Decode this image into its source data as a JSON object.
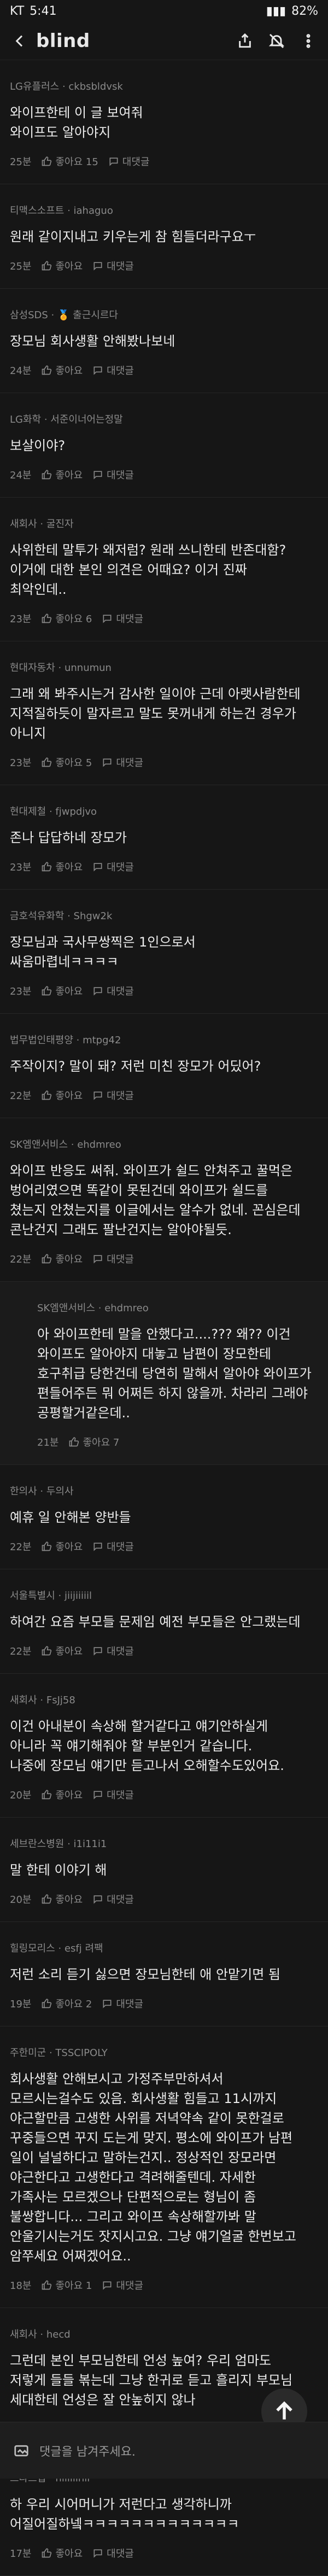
{
  "status": {
    "carrier": "KT",
    "time": "5:41",
    "battery": "82%"
  },
  "app": {
    "brand": "blind"
  },
  "comments": [
    {
      "author": "LG유플러스 · ckbsbldvsk",
      "text": "와이프한테 이 글 보여줘\n와이프도 알아야지",
      "time": "25분",
      "likes": "좋아요 15",
      "reply": "대댓글"
    },
    {
      "author": "티맥스소프트 · iahaguo",
      "text": "원래 같이지내고 키우는게 참 힘들더라구요ㅜ",
      "time": "25분",
      "likes": "좋아요",
      "reply": "대댓글"
    },
    {
      "author": "삼성SDS · 🏅 출근시르다",
      "text": "장모님 회사생활 안해봤나보네",
      "time": "24분",
      "likes": "좋아요",
      "reply": "대댓글"
    },
    {
      "author": "LG화학 · 서준이너어는정말",
      "text": "보살이야?",
      "time": "24분",
      "likes": "좋아요",
      "reply": "대댓글"
    },
    {
      "author": "새회사 · 굴진자",
      "text": "사위한테 말투가 왜저럼? 원래 쓰니한테 반존대함?\n이거에 대한 본인 의견은 어때요? 이거 진짜\n최악인데..",
      "time": "23분",
      "likes": "좋아요 6",
      "reply": "대댓글"
    },
    {
      "author": "현대자동차 · unnumun",
      "text": "그래 왜 봐주시는거 감사한 일이야 근데 아랫사람한테\n지적질하듯이 말자르고 말도 못꺼내게 하는건 경우가\n아니지",
      "time": "23분",
      "likes": "좋아요 5",
      "reply": "대댓글"
    },
    {
      "author": "현대제철 · fjwpdjvo",
      "text": "존나 답답하네 장모가",
      "time": "23분",
      "likes": "좋아요",
      "reply": "대댓글"
    },
    {
      "author": "금호석유화학 · Shgw2k",
      "text": "장모님과 국사무쌍찍은 1인으로서\n싸움마렵네ㅋㅋㅋㅋ",
      "time": "23분",
      "likes": "좋아요",
      "reply": "대댓글"
    },
    {
      "author": "법무법인태평양 · mtpg42",
      "text": "주작이지? 말이 돼? 저런 미친 장모가 어딨어?",
      "time": "22분",
      "likes": "좋아요",
      "reply": "대댓글"
    },
    {
      "author": "SK엠앤서비스 · ehdmreo",
      "text": "와이프 반응도 써줘. 와이프가 쉴드 안쳐주고 꿀먹은\n벙어리였으면 똑같이 못된건데 와이프가 쉴드를\n쳤는지 안쳤는지를 이글에서는 알수가 없네. 꼰심은데\n콘난건지 그래도 팔난건지는 알아야될듯.",
      "time": "22분",
      "likes": "좋아요",
      "reply": "대댓글"
    },
    {
      "reply_item": true,
      "author": "SK엠앤서비스 · ehdmreo",
      "text": "아 와이프한테 말을 안했다고....??? 왜?? 이건\n와이프도 알아야지 대놓고 남편이 장모한테\n호구취급 당한건데 당연히 말해서 알아야 와이프가\n편들어주든 뭐 어쩌든 하지 않을까. 차라리 그래야\n공평할거같은데..",
      "time": "21분",
      "likes": "좋아요 7",
      "reply": ""
    },
    {
      "author": "한의사 · 두의사",
      "text": "예휴 일 안해본 양반들",
      "time": "22분",
      "likes": "좋아요",
      "reply": "대댓글"
    },
    {
      "author": "서울특별시 · jiijiiiiil",
      "text": "하여간 요즘 부모들 문제임 예전 부모들은 안그랬는데",
      "time": "22분",
      "likes": "좋아요",
      "reply": "대댓글"
    },
    {
      "author": "새회사 · FsJj58",
      "text": "이건 아내분이 속상해 할거같다고 얘기안하실게\n아니라 꼭 얘기해줘야 할 부분인거 같습니다.\n나중에 장모님 얘기만 듣고나서 오해할수도있어요.",
      "time": "20분",
      "likes": "좋아요",
      "reply": "대댓글"
    },
    {
      "author": "세브란스병원 · i1i11i1",
      "text": "말 한테 이야기 해",
      "time": "20분",
      "likes": "좋아요",
      "reply": "대댓글"
    },
    {
      "author": "힐링모리스 · esfj 려팩",
      "text": "저런 소리 듣기 싫으면 장모님한테 애 안맡기면 됨",
      "time": "19분",
      "likes": "좋아요 2",
      "reply": "대댓글"
    },
    {
      "author": "주한미군 · TSSCIPOLY",
      "text": "회사생활 안해보시고 가정주부만하셔서\n모르시는걸수도 있음. 회사생활 힘들고 11시까지\n야근할만큼 고생한 사위를 저녁약속 같이 못한걸로\n꾸중들으면 꾸지 도는게 맞지. 평소에 와이프가 남편\n일이 널널하다고 말하는건지.. 정상적인 장모라면\n야근한다고 고생한다고 격려해줄텐데. 자세한\n가족사는 모르겠으나 단편적으로는 형님이 좀\n불쌍합니다... 그리고 와이프 속상해할까봐 말\n안울기시는거도 잣지시고요. 그냥 얘기얼굴 한번보고\n암쭈세요 어쩌겠어요..",
      "time": "18분",
      "likes": "좋아요 1",
      "reply": "대댓글"
    },
    {
      "author": "새회사 · hecd",
      "text": "그런데 본인 부모님한테 언성 높여? 우리 엄마도\n저렇게 들들 볶는데 그냥 한귀로 듣고 흘리지 부모님\n세대한테 언성은 잘 안높히지 않나",
      "time": "18분",
      "likes": "좋아요",
      "reply": "대댓글"
    },
    {
      "author": "스타트업 · nliiliinil",
      "text": "하 우리 시어머니가 저런다고 생각하니까\n어질어질하넼ㅋㅋㅋㅋㅋㅋㅋㅋㅋㅋㅋㅋㅋ",
      "time": "17분",
      "likes": "좋아요",
      "reply": "대댓글"
    }
  ],
  "composer": {
    "placeholder": "댓글을 남겨주세요."
  }
}
